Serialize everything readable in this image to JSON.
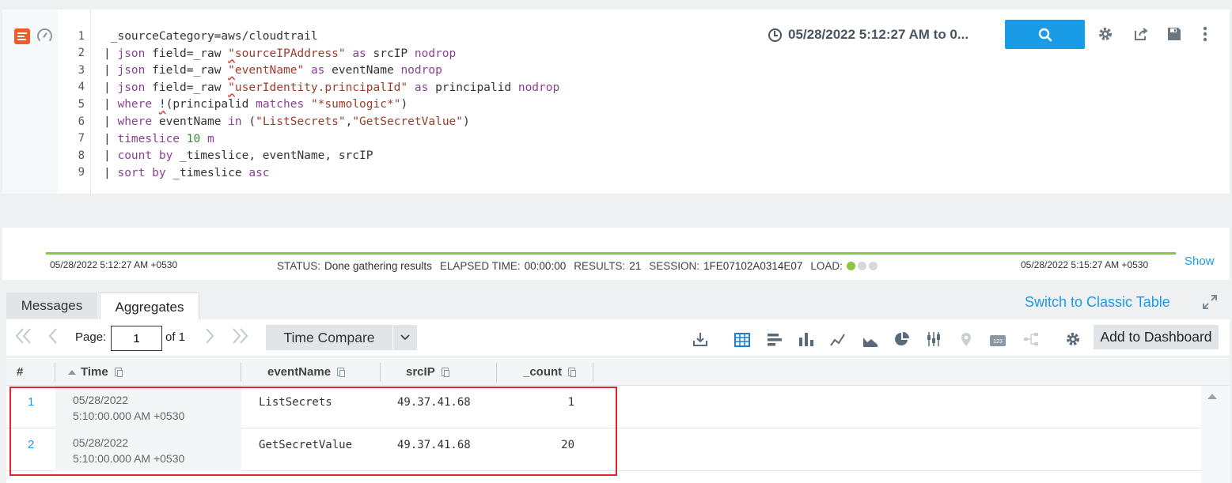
{
  "editor": {
    "line_numbers": [
      "1",
      "2",
      "3",
      "4",
      "5",
      "6",
      "7",
      "8",
      "9"
    ],
    "time_range": "05/28/2022 5:12:27 AM to 0...",
    "icons": {
      "query": "document-icon",
      "perf": "gauge-icon",
      "clock": "clock-icon",
      "search": "search-icon",
      "settings": "gear-icon",
      "share": "share-icon",
      "save": "save-icon",
      "more": "more-vertical-icon"
    }
  },
  "status": {
    "start_time": "05/28/2022 5:12:27 AM +0530",
    "end_time": "05/28/2022 5:15:27 AM +0530",
    "status_label": "STATUS:",
    "status_value": "Done gathering results",
    "elapsed_label": "ELAPSED TIME:",
    "elapsed_value": "00:00:00",
    "results_label": "RESULTS:",
    "results_value": "21",
    "session_label": "SESSION:",
    "session_value": "1FE07102A0314E07",
    "load_label": "LOAD:",
    "show_link": "Show"
  },
  "tabs": {
    "messages": "Messages",
    "aggregates": "Aggregates",
    "switch_link": "Switch to Classic Table"
  },
  "pager": {
    "page_label": "Page:",
    "page_value": "1",
    "of_label": "of 1",
    "time_compare": "Time Compare",
    "add_dashboard": "Add to Dashboard"
  },
  "table": {
    "headers": {
      "num": "#",
      "time": "Time",
      "event": "eventName",
      "src": "srcIP",
      "count": "_count"
    },
    "rows": [
      {
        "num": "1",
        "date": "05/28/2022",
        "time": "5:10:00.000 AM +0530",
        "event": "ListSecrets",
        "src": "49.37.41.68",
        "count": "1"
      },
      {
        "num": "2",
        "date": "05/28/2022",
        "time": "5:10:00.000 AM +0530",
        "event": "GetSecretValue",
        "src": "49.37.41.68",
        "count": "20"
      }
    ]
  },
  "colors": {
    "accent": "#1a9be6",
    "progress": "#8cc63f",
    "highlight": "#e0262c",
    "brand": "#f0592a"
  }
}
